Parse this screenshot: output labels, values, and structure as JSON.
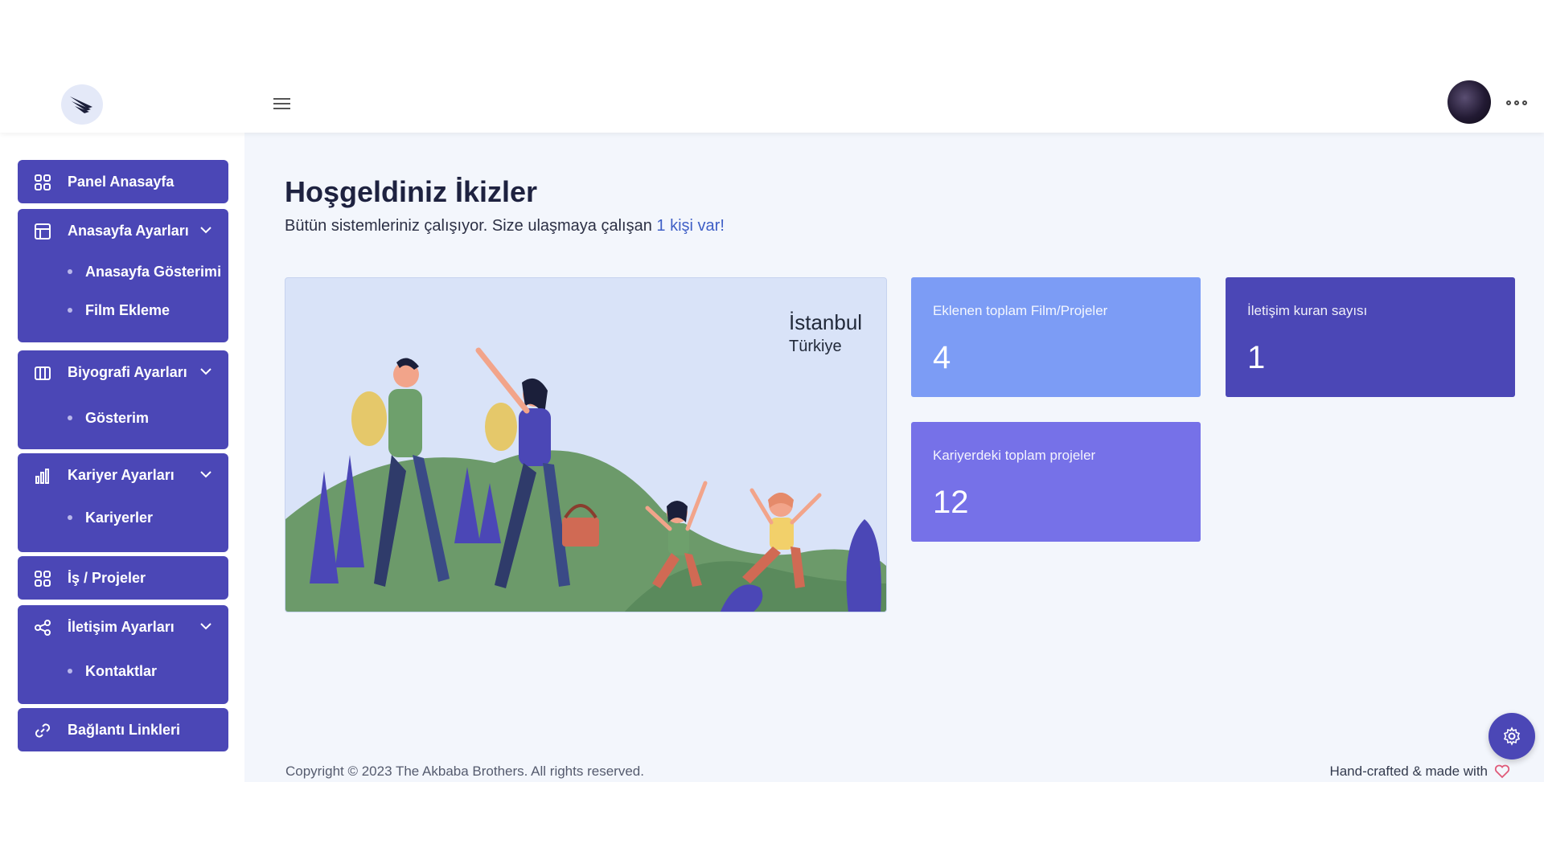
{
  "header": {
    "logo_icon": "bird-logo-icon",
    "menu_icon": "hamburger-icon",
    "more_icon": "more-dots-icon"
  },
  "sidebar": {
    "items": [
      {
        "label": "Panel Anasayfa",
        "icon": "grid-icon"
      },
      {
        "label": "Anasayfa Ayarları",
        "icon": "layout-icon",
        "children": [
          "Anasayfa Gösterimi",
          "Film Ekleme"
        ]
      },
      {
        "label": "Biyografi Ayarları",
        "icon": "columns-icon",
        "children": [
          "Gösterim"
        ]
      },
      {
        "label": "Kariyer Ayarları",
        "icon": "bar-chart-icon",
        "children": [
          "Kariyerler"
        ]
      },
      {
        "label": "İş / Projeler",
        "icon": "grid-icon"
      },
      {
        "label": "İletişim Ayarları",
        "icon": "share-icon",
        "children": [
          "Kontaktlar"
        ]
      },
      {
        "label": "Bağlantı Linkleri",
        "icon": "link-icon"
      }
    ]
  },
  "main": {
    "title": "Hoşgeldiniz İkizler",
    "subtitle_prefix": "Bütün sistemleriniz çalışıyor. Size ulaşmaya çalışan ",
    "subtitle_link": "1 kişi var!",
    "hero": {
      "city": "İstanbul",
      "country": "Türkiye"
    },
    "stats": [
      {
        "label": "Eklenen toplam Film/Projeler",
        "value": "4",
        "color": "#7c9cf5"
      },
      {
        "label": "İletişim kuran sayısı",
        "value": "1",
        "color": "#4b47b6"
      },
      {
        "label": "Kariyerdeki toplam projeler",
        "value": "12",
        "color": "#7671e8"
      }
    ]
  },
  "footer": {
    "copyright": "Copyright © 2023 The Akbaba Brothers. All rights reserved.",
    "crafted": "Hand-crafted & made with",
    "heart_icon": "heart-icon"
  },
  "colors": {
    "accent": "#4b47b6",
    "background": "#f3f6fc"
  }
}
